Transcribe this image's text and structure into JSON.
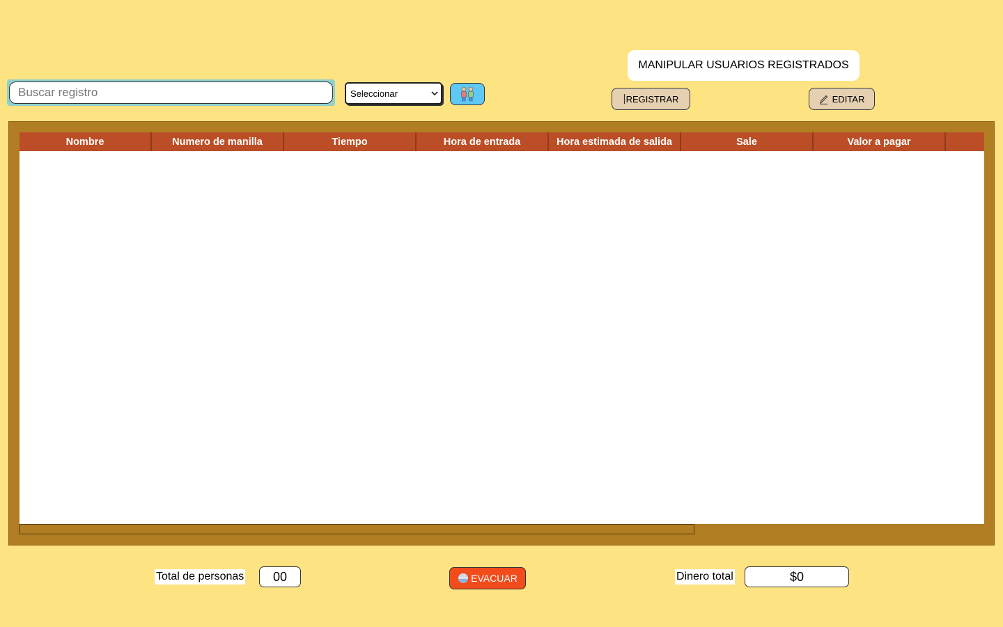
{
  "search": {
    "placeholder": "Buscar registro",
    "value": ""
  },
  "filter": {
    "selected": "Seleccionar"
  },
  "people_button": {
    "icon": "people-icon"
  },
  "manage": {
    "title": "MANIPULAR USUARIOS REGISTRADOS",
    "registrar_label": "REGISTRAR",
    "editar_label": "EDITAR",
    "registrar_icon": "cursor-icon",
    "editar_icon": "pencil-icon"
  },
  "table": {
    "columns": [
      "Nombre",
      "Numero de manilla",
      "Tiempo",
      "Hora de entrada",
      "Hora estimada de salida",
      "Sale",
      "Valor a pagar",
      ""
    ],
    "rows": []
  },
  "footer": {
    "total_personas_label": "Total de personas",
    "total_personas_value": "00",
    "evacuar_label": "EVACUAR",
    "evacuar_icon": "circle-icon",
    "dinero_total_label": "Dinero total",
    "dinero_total_value": "$0"
  },
  "colors": {
    "background": "#fee383",
    "table_frame": "#b27e23",
    "table_header": "#bb4e26",
    "evacuar": "#f24c1c",
    "people_button": "#5fc8f4",
    "tool_button": "#e6d0b2"
  }
}
